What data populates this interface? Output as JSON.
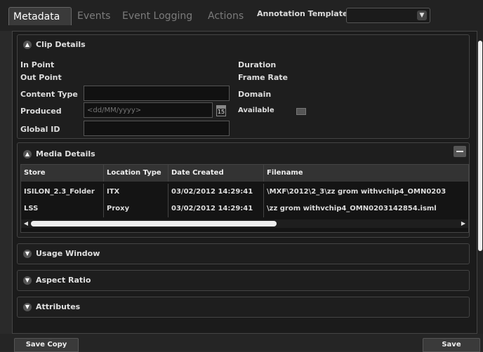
{
  "tabs": [
    {
      "label": "Metadata",
      "active": true
    },
    {
      "label": "Events",
      "active": false
    },
    {
      "label": "Event Logging",
      "active": false
    },
    {
      "label": "Actions",
      "active": false
    }
  ],
  "annotation": {
    "label": "Annotation Template",
    "value": ""
  },
  "clip_details": {
    "title": "Clip Details",
    "in_point_label": "In Point",
    "out_point_label": "Out Point",
    "content_type_label": "Content Type",
    "produced_label": "Produced",
    "produced_placeholder": "<dd/MM/yyyy>",
    "calendar_day": "15",
    "global_id_label": "Global ID",
    "duration_label": "Duration",
    "frame_rate_label": "Frame Rate",
    "domain_label": "Domain",
    "available_label": "Available"
  },
  "media_details": {
    "title": "Media Details",
    "columns": [
      "Store",
      "Location Type",
      "Date Created",
      "Filename"
    ],
    "rows": [
      [
        "ISILON_2.3_Folder",
        "ITX",
        "03/02/2012 14:29:41",
        "\\MXF\\2012\\2_3\\zz grom withvchip4_OMN0203"
      ],
      [
        "LSS",
        "Proxy",
        "03/02/2012 14:29:41",
        "\\zz grom withvchip4_OMN0203142854.isml"
      ]
    ]
  },
  "collapsed_sections": [
    "Usage Window",
    "Aspect Ratio",
    "Attributes"
  ],
  "buttons": {
    "save_copy": "Save Copy",
    "save": "Save"
  },
  "colors": {
    "background": "#2a2a2a",
    "panel": "#1b1b1b",
    "text": "#dddddd"
  }
}
